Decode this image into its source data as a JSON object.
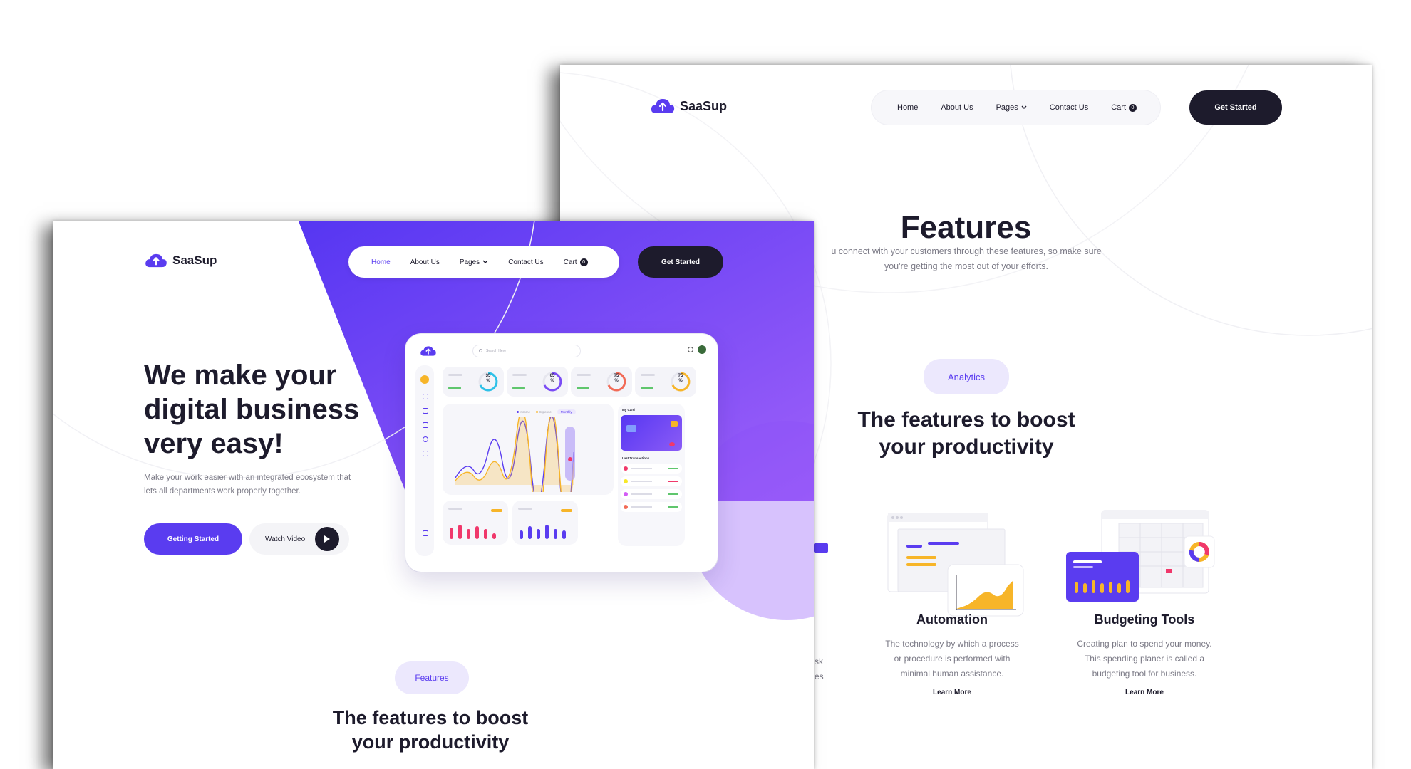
{
  "back_page": {
    "brand": "SaaSup",
    "nav": [
      "Home",
      "About Us",
      "Pages",
      "Contact Us",
      "Cart"
    ],
    "cart_count": "0",
    "cta": "Get Started",
    "page_title": "Features",
    "intro_line1": "u connect with your customers through these  features, so make sure",
    "intro_line2": "you're getting the most out of your efforts.",
    "badge": "Analytics",
    "heading_line1": "The features to boost",
    "heading_line2": "your productivity",
    "partial_text1": "sk",
    "partial_text2": "es",
    "features": [
      {
        "title": "Automation",
        "desc_line1": "The technology by which a process",
        "desc_line2": "or procedure is performed with",
        "desc_line3": "minimal human assistance.",
        "link": "Learn More"
      },
      {
        "title": "Budgeting Tools",
        "desc_line1": "Creating plan to spend your money.",
        "desc_line2": "This spending planer is called a",
        "desc_line3": "budgeting tool for business.",
        "link": "Learn More"
      }
    ]
  },
  "front_page": {
    "brand": "SaaSup",
    "nav": [
      "Home",
      "About Us",
      "Pages",
      "Contact Us",
      "Cart"
    ],
    "cart_count": "0",
    "cta": "Get Started",
    "hero_line1": "We make your",
    "hero_line2": "digital business",
    "hero_line3": "very easy!",
    "sub_line1": "Make your work easier with an integrated ecosystem that",
    "sub_line2": "lets all departments work properly together.",
    "btn_primary": "Getting Started",
    "btn_secondary": "Watch Video",
    "badge": "Features",
    "heading_line1": "The features to boost",
    "heading_line2": "your productivity",
    "dashboard": {
      "search_placeholder": "Search Here",
      "stats": [
        "35",
        "65",
        "75",
        "75"
      ],
      "stat_unit": "%",
      "legend_a": "Income",
      "legend_b": "Expense",
      "period": "Monthly",
      "card_label": "My Card",
      "transactions_label": "Last Transactions"
    }
  },
  "colors": {
    "accent": "#5a3cf0",
    "accent_light": "#9a5cf8",
    "dark": "#1d1b2c",
    "yellow": "#f7b529",
    "pink": "#f0386b"
  }
}
